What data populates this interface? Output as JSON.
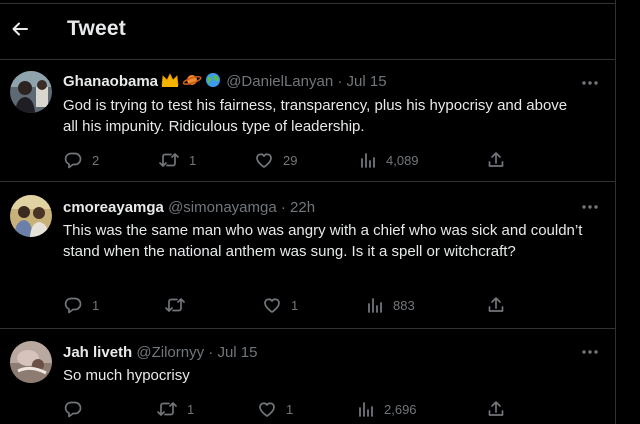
{
  "header": {
    "title": "Tweet"
  },
  "tweets": [
    {
      "name": "Ghanaobama",
      "name_emojis": [
        "crown",
        "ringed-planet",
        "globe"
      ],
      "handle": "@DanielLanyan",
      "time": "Jul 15",
      "text": "God is trying to test his fairness, transparency, plus his hypocrisy and above all his impunity. Ridiculous type of leadership.",
      "replies": "2",
      "retweets": "1",
      "likes": "29",
      "views": "4,089"
    },
    {
      "name": "cmoreayamga",
      "handle": "@simonayamga",
      "time": "22h",
      "text": "This was the same man who was angry with a chief who was sick and couldn’t stand when the national anthem was sung. Is it a spell or witchcraft?",
      "replies": "1",
      "retweets": "",
      "likes": "1",
      "views": "883"
    },
    {
      "name": "Jah liveth",
      "handle": "@Zilornyy",
      "time": "Jul 15",
      "text": "So much hypocrisy",
      "replies": "",
      "retweets": "1",
      "likes": "1",
      "views": "2,696"
    }
  ],
  "separator": "·",
  "icons": {
    "back": "arrow-left-icon",
    "more": "more-horizontal-icon",
    "reply": "reply-icon",
    "retweet": "retweet-icon",
    "like": "heart-icon",
    "views": "views-icon",
    "share": "share-icon"
  },
  "colors": {
    "background": "#000000",
    "text": "#e7e9ea",
    "secondary": "#71767b",
    "border": "#2f3336"
  }
}
